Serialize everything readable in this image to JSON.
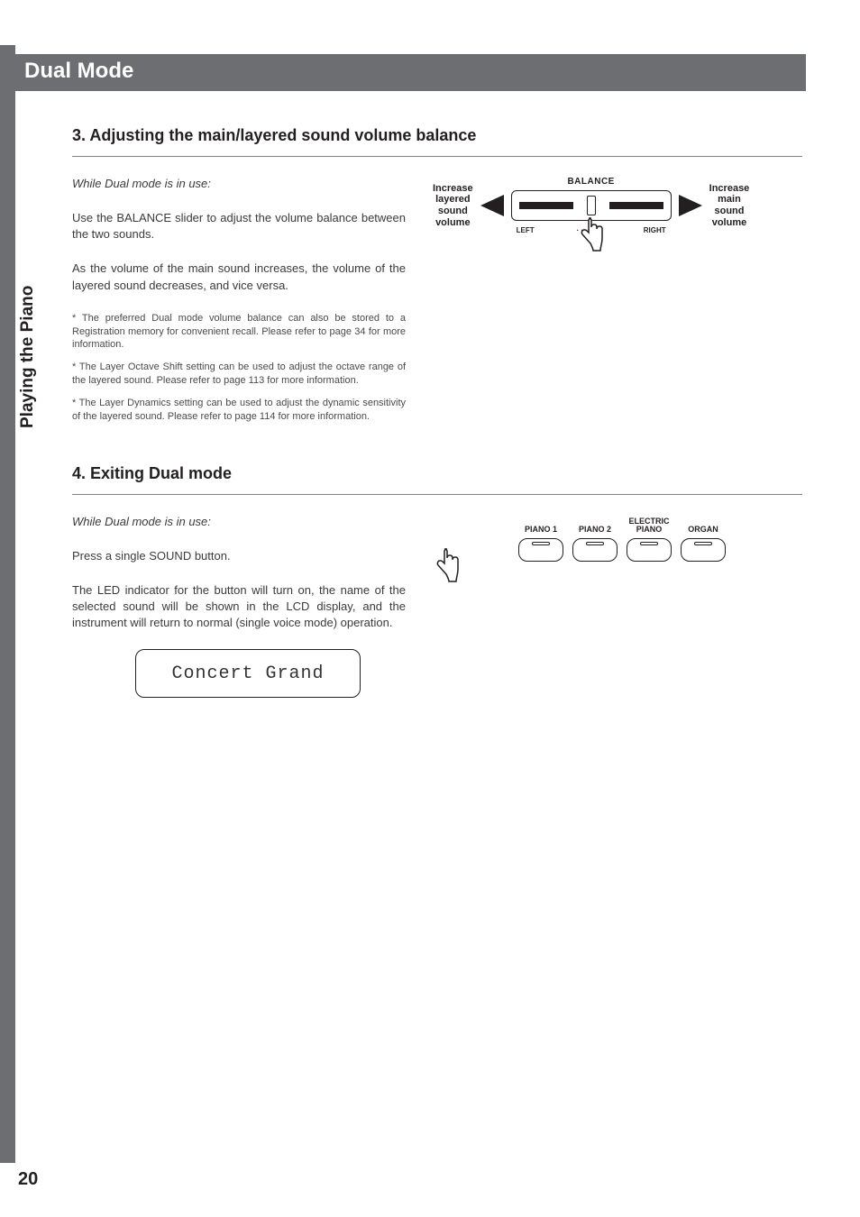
{
  "page_number": "20",
  "sidebar_label": "Playing the Piano",
  "title": "Dual Mode",
  "section3": {
    "heading": "3. Adjusting the main/layered sound volume balance",
    "intro": "While Dual mode is in use:",
    "p1": "Use the BALANCE slider to adjust the volume balance between the two sounds.",
    "p2": "As the volume of the main sound increases, the volume of the layered sound decreases, and vice versa.",
    "n1": "* The preferred Dual mode volume balance can also be stored to a Registration memory for convenient recall. Please refer to page 34 for more information.",
    "n2": "* The Layer Octave Shift setting can be used to adjust the octave range of the layered sound.  Please refer to page 113 for more information.",
    "n3": "* The Layer Dynamics setting can be used to adjust the dynamic sensitivity of the layered sound.  Please refer to page 114 for more information.",
    "fig": {
      "left_label": "Increase\nlayered\nsound\nvolume",
      "right_label": "Increase\nmain\nsound\nvolume",
      "balance": "BALANCE",
      "left": "LEFT",
      "right": "RIGHT"
    }
  },
  "section4": {
    "heading": "4. Exiting Dual mode",
    "intro": "While Dual mode is in use:",
    "p1": "Press a single SOUND button.",
    "p2": "The LED indicator for the button will turn on, the name of the selected sound will be shown in the LCD display, and the instrument will return to normal (single voice mode) operation.",
    "lcd": "Concert Grand",
    "buttons": [
      "PIANO 1",
      "PIANO 2",
      "ELECTRIC\nPIANO",
      "ORGAN"
    ]
  }
}
